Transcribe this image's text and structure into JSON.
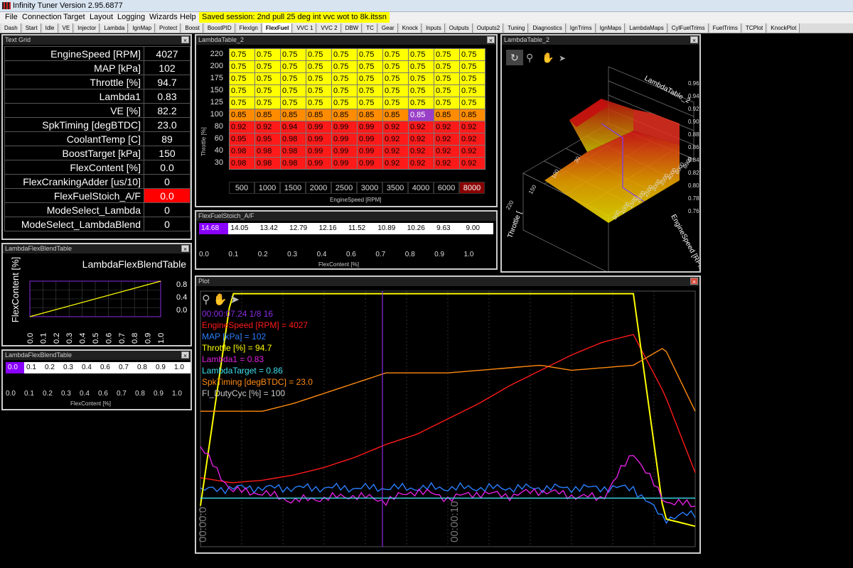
{
  "app": {
    "title": "Infinity Tuner Version 2.95.6877",
    "session": "Saved session: 2nd pull 25 deg int vvc wot to 8k.itssn"
  },
  "menu": [
    "File",
    "Connection",
    "Target",
    "Layout",
    "Logging",
    "Wizards",
    "Help"
  ],
  "tabs": [
    "Dash",
    "Start",
    "Idle",
    "VE",
    "Injector",
    "Lambda",
    "IgnMap",
    "Protect",
    "Boost",
    "BoostPID",
    "FlexIgn",
    "FlexFuel",
    "VVC 1",
    "VVC 2",
    "DBW",
    "TC",
    "Gear",
    "Knock",
    "Inputs",
    "Outputs",
    "Outputs2",
    "Tuning",
    "Diagnostics",
    "IgnTrims",
    "IgnMaps",
    "LambdaMaps",
    "CylFuelTrims",
    "FuelTrims",
    "TCPlot",
    "KnockPlot"
  ],
  "active_tab": "FlexFuel",
  "text_grid": {
    "title": "Text Grid",
    "rows": [
      {
        "name": "EngineSpeed [RPM]",
        "value": "4027"
      },
      {
        "name": "MAP [kPa]",
        "value": "102"
      },
      {
        "name": "Throttle [%]",
        "value": "94.7"
      },
      {
        "name": "Lambda1",
        "value": "0.83"
      },
      {
        "name": "VE [%]",
        "value": "82.2"
      },
      {
        "name": "SpkTiming [degBTDC]",
        "value": "23.0"
      },
      {
        "name": "CoolantTemp [C]",
        "value": "89"
      },
      {
        "name": "BoostTarget [kPa]",
        "value": "150"
      },
      {
        "name": "FlexContent [%]",
        "value": "0.0"
      },
      {
        "name": "FlexCrankingAdder [us/10]",
        "value": "0"
      },
      {
        "name": "FlexFuelStoich_A/F",
        "value": "0.0",
        "alert": true
      },
      {
        "name": "ModeSelect_Lambda",
        "value": "0"
      },
      {
        "name": "ModeSelect_LambdaBlend",
        "value": "0"
      }
    ]
  },
  "lambda_table": {
    "title": "LambdaTable_2",
    "ylabel": "Throttle [%]",
    "xlabel": "EngineSpeed [RPM]",
    "rows": [
      "220",
      "200",
      "175",
      "150",
      "125",
      "100",
      "80",
      "60",
      "40",
      "30"
    ],
    "cols": [
      "500",
      "1000",
      "1500",
      "2000",
      "2500",
      "3000",
      "3500",
      "4000",
      "6000",
      "8000"
    ],
    "cells": [
      [
        "0.75",
        "0.75",
        "0.75",
        "0.75",
        "0.75",
        "0.75",
        "0.75",
        "0.75",
        "0.75",
        "0.75"
      ],
      [
        "0.75",
        "0.75",
        "0.75",
        "0.75",
        "0.75",
        "0.75",
        "0.75",
        "0.75",
        "0.75",
        "0.75"
      ],
      [
        "0.75",
        "0.75",
        "0.75",
        "0.75",
        "0.75",
        "0.75",
        "0.75",
        "0.75",
        "0.75",
        "0.75"
      ],
      [
        "0.75",
        "0.75",
        "0.75",
        "0.75",
        "0.75",
        "0.75",
        "0.75",
        "0.75",
        "0.75",
        "0.75"
      ],
      [
        "0.75",
        "0.75",
        "0.75",
        "0.75",
        "0.75",
        "0.75",
        "0.75",
        "0.75",
        "0.75",
        "0.75"
      ],
      [
        "0.85",
        "0.85",
        "0.85",
        "0.85",
        "0.85",
        "0.85",
        "0.85",
        "0.85",
        "0.85",
        "0.85"
      ],
      [
        "0.92",
        "0.92",
        "0.94",
        "0.99",
        "0.99",
        "0.99",
        "0.92",
        "0.92",
        "0.92",
        "0.92"
      ],
      [
        "0.95",
        "0.95",
        "0.98",
        "0.99",
        "0.99",
        "0.99",
        "0.92",
        "0.92",
        "0.92",
        "0.92"
      ],
      [
        "0.98",
        "0.98",
        "0.98",
        "0.99",
        "0.99",
        "0.99",
        "0.92",
        "0.92",
        "0.92",
        "0.92"
      ],
      [
        "0.98",
        "0.98",
        "0.98",
        "0.99",
        "0.99",
        "0.99",
        "0.92",
        "0.92",
        "0.92",
        "0.92"
      ]
    ],
    "highlight": {
      "row": 5,
      "col": 7
    },
    "colors": {
      "yellow": "#ffff00",
      "orange": "#ff8c00",
      "red": "#ff1a1a",
      "highlight": "#9a3fc8"
    }
  },
  "lambda3d": {
    "title": "LambdaTable_2",
    "axis_a": "LambdaTable_2",
    "axis_b": "EngineSpeed [RPM]",
    "axis_c": "Throttle [",
    "z_ticks": [
      "0.96",
      "0.94",
      "0.92",
      "0.90",
      "0.88",
      "0.86",
      "0.84",
      "0.82",
      "0.80",
      "0.78",
      "0.76"
    ],
    "rpm_ticks": [
      "500",
      "1000",
      "1500",
      "2000",
      "2500",
      "3000",
      "3500",
      "4000",
      "6000",
      "8000"
    ],
    "thr_ticks": [
      "220",
      "150",
      "100",
      "30"
    ]
  },
  "flexstoich": {
    "title": "FlexFuelStoich_A/F",
    "values": [
      "14.68",
      "14.05",
      "13.42",
      "12.79",
      "12.16",
      "11.52",
      "10.89",
      "10.26",
      "9.63",
      "9.00"
    ],
    "axis": [
      "0.0",
      "0.1",
      "0.2",
      "0.3",
      "0.4",
      "0.6",
      "0.7",
      "0.8",
      "0.9",
      "1.0"
    ],
    "xlabel": "FlexContent [%]"
  },
  "blend_graph": {
    "title": "LambdaFlexBlendTable",
    "chart_title": "LambdaFlexBlendTable",
    "ylabel": "FlexContent [%]",
    "yticks": [
      "0.8",
      "0.4",
      "0.0"
    ],
    "xticks": [
      "0.0",
      "0.1",
      "0.2",
      "0.3",
      "0.4",
      "0.5",
      "0.6",
      "0.7",
      "0.8",
      "0.9",
      "1.0"
    ]
  },
  "blend_table": {
    "title": "LambdaFlexBlendTable",
    "values": [
      "0.0",
      "0.1",
      "0.2",
      "0.3",
      "0.4",
      "0.6",
      "0.7",
      "0.8",
      "0.9",
      "1.0"
    ],
    "axis": [
      "0.0",
      "0.1",
      "0.2",
      "0.3",
      "0.4",
      "0.6",
      "0.7",
      "0.8",
      "0.9",
      "1.0"
    ],
    "xlabel": "FlexContent [%]"
  },
  "plot": {
    "title": "Plot",
    "time": "00:00:07.24 1/8 16",
    "time_ticks": [
      "00:00:0",
      "00:00:10"
    ],
    "legend": [
      {
        "text": "EngineSpeed [RPM] = 4027",
        "color": "#ff1a1a"
      },
      {
        "text": "MAP [kPa] = 102",
        "color": "#2a7fff"
      },
      {
        "text": "Throttle [%] = 94.7",
        "color": "#ffff00"
      },
      {
        "text": "Lambda1 = 0.83",
        "color": "#e020e0"
      },
      {
        "text": "LambdaTarget = 0.86",
        "color": "#40e0f0"
      },
      {
        "text": "SpkTiming [degBTDC] = 23.0",
        "color": "#ff8a10"
      },
      {
        "text": "FI_DutyCyc [%] = 100",
        "color": "#c8c8c8"
      }
    ]
  },
  "chart_data": [
    {
      "type": "line",
      "title": "LambdaFlexBlendTable",
      "ylabel": "FlexContent [%]",
      "x": [
        0,
        1
      ],
      "series": [
        {
          "values": [
            0,
            1
          ]
        }
      ],
      "ylim": [
        0,
        1
      ],
      "xlim": [
        0,
        1
      ]
    },
    {
      "type": "line",
      "x": [
        0,
        1,
        2,
        3,
        4,
        5,
        6,
        7,
        8,
        9,
        10,
        11,
        12,
        13,
        14,
        15,
        16
      ],
      "series": [
        {
          "name": "EngineSpeed [RPM]",
          "color": "#ff1a1a",
          "values": [
            0.27,
            0.25,
            0.26,
            0.28,
            0.31,
            0.35,
            0.4,
            0.44,
            0.5,
            0.56,
            0.63,
            0.69,
            0.75,
            0.8,
            0.83,
            0.6,
            0.29
          ]
        },
        {
          "name": "MAP [kPa]",
          "color": "#2a7fff",
          "values": [
            0.22,
            0.23,
            0.23,
            0.23,
            0.23,
            0.23,
            0.23,
            0.23,
            0.23,
            0.23,
            0.23,
            0.23,
            0.23,
            0.23,
            0.23,
            0.11,
            0.13
          ]
        },
        {
          "name": "Throttle [%]",
          "color": "#ffff00",
          "values": [
            0.16,
            0.99,
            0.99,
            0.99,
            0.99,
            0.99,
            0.99,
            0.99,
            0.99,
            0.99,
            0.99,
            0.99,
            0.99,
            0.99,
            0.99,
            0.11,
            0.08
          ]
        },
        {
          "name": "Lambda1",
          "color": "#e020e0",
          "values": [
            0.39,
            0.22,
            0.21,
            0.18,
            0.19,
            0.2,
            0.18,
            0.22,
            0.19,
            0.21,
            0.2,
            0.22,
            0.2,
            0.19,
            0.37,
            0.18,
            0.16
          ]
        },
        {
          "name": "LambdaTarget",
          "color": "#40e0f0",
          "values": [
            0.19,
            0.19,
            0.19,
            0.19,
            0.19,
            0.19,
            0.19,
            0.19,
            0.19,
            0.19,
            0.19,
            0.19,
            0.19,
            0.19,
            0.19,
            0.19,
            0.19
          ]
        },
        {
          "name": "SpkTiming [degBTDC]",
          "color": "#ff8a10",
          "values": [
            0.53,
            0.53,
            0.53,
            0.56,
            0.6,
            0.64,
            0.68,
            0.68,
            0.68,
            0.69,
            0.7,
            0.71,
            0.69,
            0.7,
            0.71,
            0.78,
            0.53
          ]
        }
      ]
    }
  ]
}
